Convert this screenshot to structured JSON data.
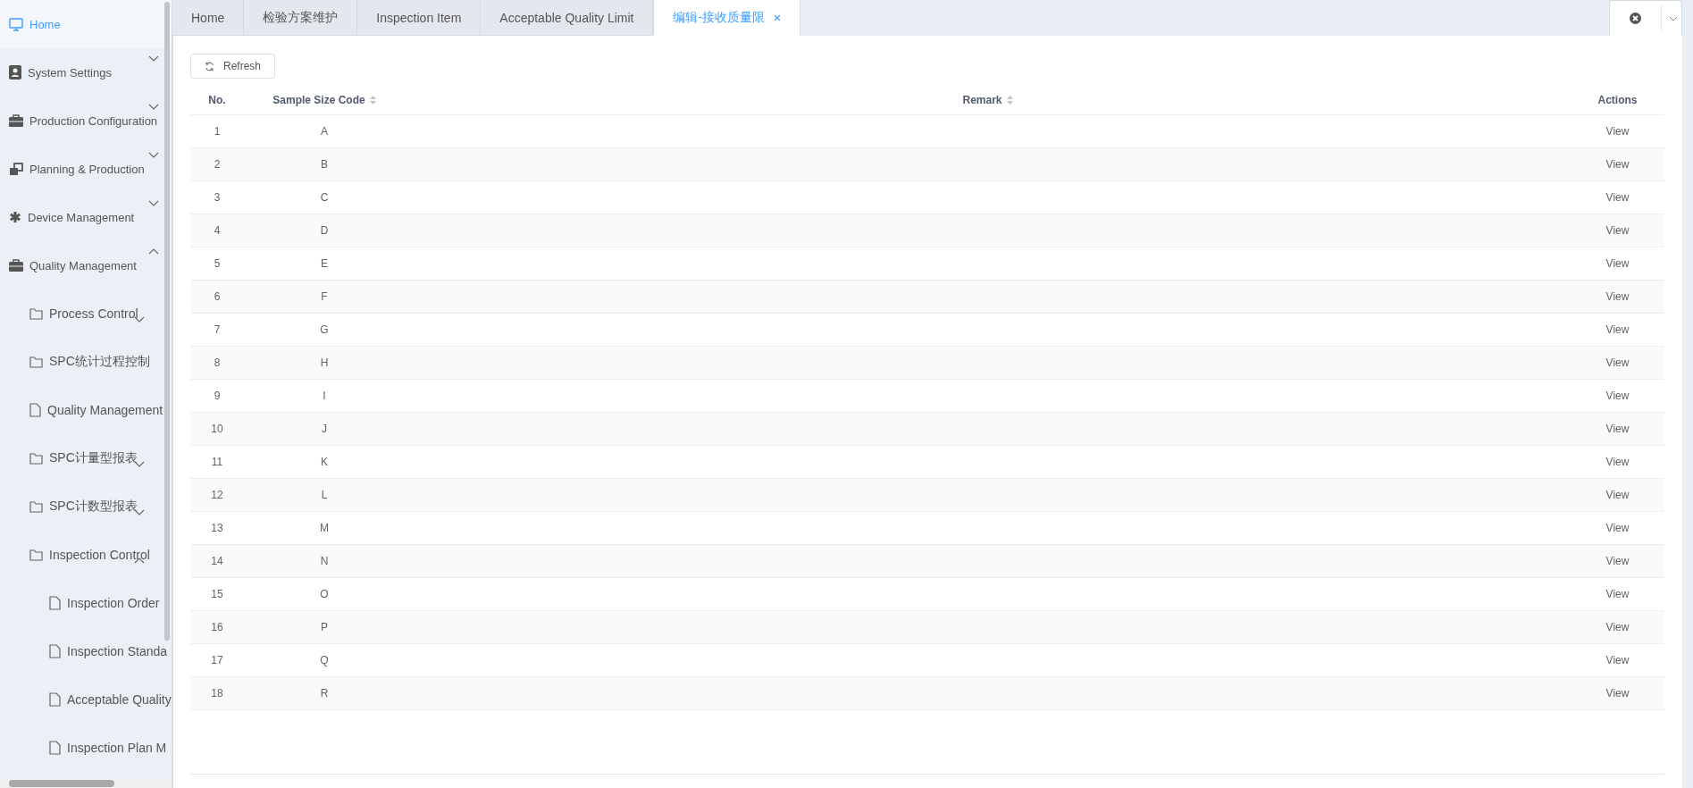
{
  "sidebar": {
    "items": [
      {
        "label": "Home",
        "selected": true
      },
      {
        "label": "System Settings",
        "selected": false,
        "expanded": false
      },
      {
        "label": "Production Configuration",
        "selected": false,
        "expanded": false
      },
      {
        "label": "Planning & Production",
        "selected": false,
        "expanded": false
      },
      {
        "label": "Device Management",
        "selected": false,
        "expanded": false
      },
      {
        "label": "Quality Management",
        "selected": false,
        "expanded": true,
        "children": [
          {
            "label": "Process Control",
            "kind": "folder",
            "expanded": false
          },
          {
            "label": "SPC统计过程控制",
            "kind": "folder"
          },
          {
            "label": "Quality Management",
            "kind": "page"
          },
          {
            "label": "SPC计量型报表",
            "kind": "folder",
            "expanded": false
          },
          {
            "label": "SPC计数型报表",
            "kind": "folder",
            "expanded": false
          },
          {
            "label": "Inspection Control",
            "kind": "folder",
            "expanded": true,
            "children": [
              {
                "label": "Inspection Order",
                "kind": "page"
              },
              {
                "label": "Inspection Standa",
                "kind": "page"
              },
              {
                "label": "Acceptable Quality",
                "kind": "page"
              },
              {
                "label": "Inspection Plan M",
                "kind": "page"
              }
            ]
          }
        ]
      }
    ]
  },
  "tabs": [
    {
      "label": "Home",
      "selected": false
    },
    {
      "label": "检验方案维护",
      "selected": false
    },
    {
      "label": "Inspection Item",
      "selected": false
    },
    {
      "label": "Acceptable Quality Limit",
      "selected": false
    },
    {
      "label": "编辑-接收质量限",
      "selected": true,
      "closable": true
    }
  ],
  "toolbar": {
    "refresh": "Refresh"
  },
  "table": {
    "columns": [
      "No.",
      "Sample Size Code",
      "Remark",
      "Actions"
    ],
    "rows": [
      {
        "no": "1",
        "code": "A",
        "action": "View"
      },
      {
        "no": "2",
        "code": "B",
        "action": "View"
      },
      {
        "no": "3",
        "code": "C",
        "action": "View"
      },
      {
        "no": "4",
        "code": "D",
        "action": "View"
      },
      {
        "no": "5",
        "code": "E",
        "action": "View"
      },
      {
        "no": "6",
        "code": "F",
        "action": "View"
      },
      {
        "no": "7",
        "code": "G",
        "action": "View"
      },
      {
        "no": "8",
        "code": "H",
        "action": "View"
      },
      {
        "no": "9",
        "code": "I",
        "action": "View"
      },
      {
        "no": "10",
        "code": "J",
        "action": "View"
      },
      {
        "no": "11",
        "code": "K",
        "action": "View"
      },
      {
        "no": "12",
        "code": "L",
        "action": "View"
      },
      {
        "no": "13",
        "code": "M",
        "action": "View"
      },
      {
        "no": "14",
        "code": "N",
        "action": "View"
      },
      {
        "no": "15",
        "code": "O",
        "action": "View"
      },
      {
        "no": "16",
        "code": "P",
        "action": "View"
      },
      {
        "no": "17",
        "code": "Q",
        "action": "View"
      },
      {
        "no": "18",
        "code": "R",
        "action": "View"
      }
    ]
  }
}
